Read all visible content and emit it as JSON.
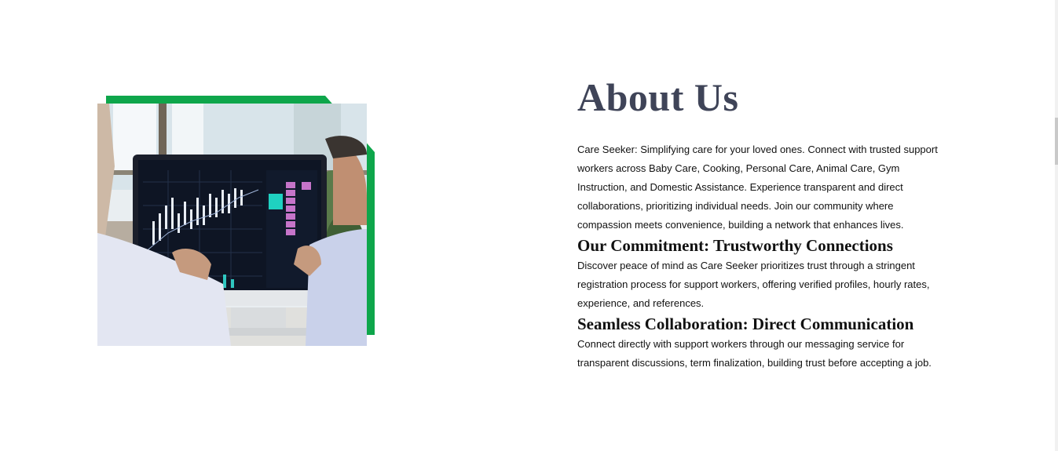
{
  "about": {
    "title": "About Us",
    "intro": "Care Seeker: Simplifying care for your loved ones. Connect with trusted support workers across Baby Care, Cooking, Personal Care, Animal Care, Gym Instruction, and Domestic Assistance. Experience transparent and direct collaborations, prioritizing individual needs. Join our community where compassion meets convenience, building a network that enhances lives.",
    "sections": [
      {
        "heading": "Our Commitment: Trustworthy Connections",
        "text": "Discover peace of mind as Care Seeker prioritizes trust through a stringent registration process for support workers, offering verified profiles, hourly rates, experience, and references."
      },
      {
        "heading": "Seamless Collaboration: Direct Communication",
        "text": "Connect directly with support workers through our messaging service for transparent discussions, term finalization, building trust before accepting a job."
      }
    ]
  },
  "image": {
    "icon": "trading-monitor-photo",
    "frame_color": "#0ea64b"
  },
  "colors": {
    "heading": "#3f4458",
    "text": "#111111",
    "accent": "#0ea64b"
  }
}
